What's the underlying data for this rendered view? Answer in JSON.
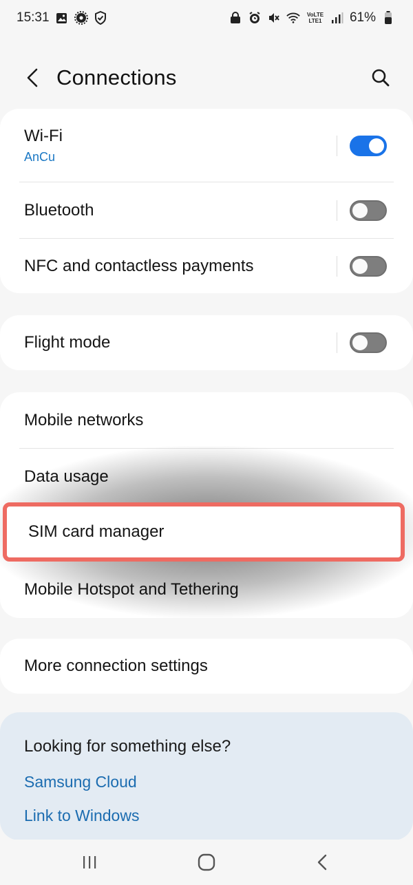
{
  "status_bar": {
    "time": "15:31",
    "battery": "61%",
    "left_icons": [
      "gallery-icon",
      "settings-gear-icon",
      "shield-check-icon"
    ],
    "right_icons": [
      "lock-icon",
      "alarm-icon",
      "mute-icon",
      "wifi-icon",
      "volte-lte-icon",
      "signal-icon",
      "battery-icon"
    ],
    "volte_text": "VoLTE LTE1"
  },
  "header": {
    "title": "Connections",
    "back_icon": "back-chevron-icon",
    "search_icon": "search-icon"
  },
  "group1": {
    "wifi": {
      "label": "Wi-Fi",
      "network": "AnCu",
      "toggle_on": true
    },
    "bluetooth": {
      "label": "Bluetooth",
      "toggle_on": false
    },
    "nfc": {
      "label": "NFC and contactless payments",
      "toggle_on": false
    }
  },
  "group2": {
    "flight_mode": {
      "label": "Flight mode",
      "toggle_on": false
    }
  },
  "group3": {
    "mobile_networks": "Mobile networks",
    "data_usage": "Data usage",
    "sim_card_manager": "SIM card manager",
    "hotspot": "Mobile Hotspot and Tethering"
  },
  "group4": {
    "more_settings": "More connection settings"
  },
  "suggestions": {
    "title": "Looking for something else?",
    "links": [
      "Samsung Cloud",
      "Link to Windows"
    ]
  },
  "colors": {
    "accent": "#1a73e8",
    "link": "#1b6cb0",
    "highlight": "#ee6b62",
    "background": "#f6f6f6",
    "suggest_bg": "#e3ebf3"
  }
}
